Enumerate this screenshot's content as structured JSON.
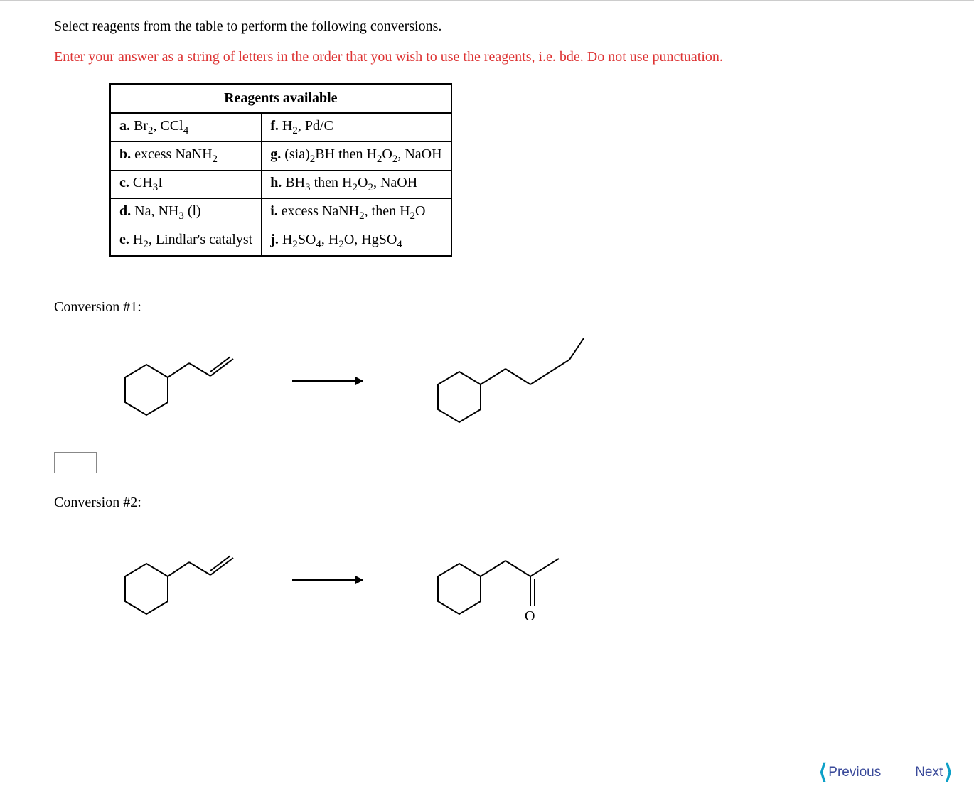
{
  "question": "Select reagents from the table to perform the following conversions.",
  "instruction": "Enter your answer as a string of letters in the order that you wish to use the reagents, i.e. bde. Do not use punctuation.",
  "table": {
    "header": "Reagents available",
    "rows": [
      {
        "left": {
          "letter": "a.",
          "text": "Br₂, CCl₄"
        },
        "right": {
          "letter": "f.",
          "text": "H₂, Pd/C"
        }
      },
      {
        "left": {
          "letter": "b.",
          "text": "excess NaNH₂"
        },
        "right": {
          "letter": "g.",
          "text": "(sia)₂BH then H₂O₂, NaOH"
        }
      },
      {
        "left": {
          "letter": "c.",
          "text": "CH₃I"
        },
        "right": {
          "letter": "h.",
          "text": "BH₃ then H₂O₂, NaOH"
        }
      },
      {
        "left": {
          "letter": "d.",
          "text": "Na, NH₃ (l)"
        },
        "right": {
          "letter": "i.",
          "text": "excess NaNH₂, then H₂O"
        }
      },
      {
        "left": {
          "letter": "e.",
          "text": "H₂, Lindlar's catalyst"
        },
        "right": {
          "letter": "j.",
          "text": "H₂SO₄, H₂O, HgSO₄"
        }
      }
    ]
  },
  "conversion1_label": "Conversion #1:",
  "conversion2_label": "Conversion #2:",
  "answer1_value": "",
  "nav": {
    "previous": "Previous",
    "next": "Next"
  },
  "structures": {
    "conv1_start": "cyclohexyl-CH₂-CH=CH₂ (allylcyclohexane, terminal alkene)",
    "conv1_product": "cyclohexyl-CH₂-CH₂-CH₂-CH₃ (extended saturated/trans chain)",
    "conv2_start": "cyclohexyl-CH₂-CH=CH₂ (allylcyclohexane, terminal alkene)",
    "conv2_product": "cyclohexyl-CH₂-C(=O)-CH₃ (methyl ketone)"
  }
}
